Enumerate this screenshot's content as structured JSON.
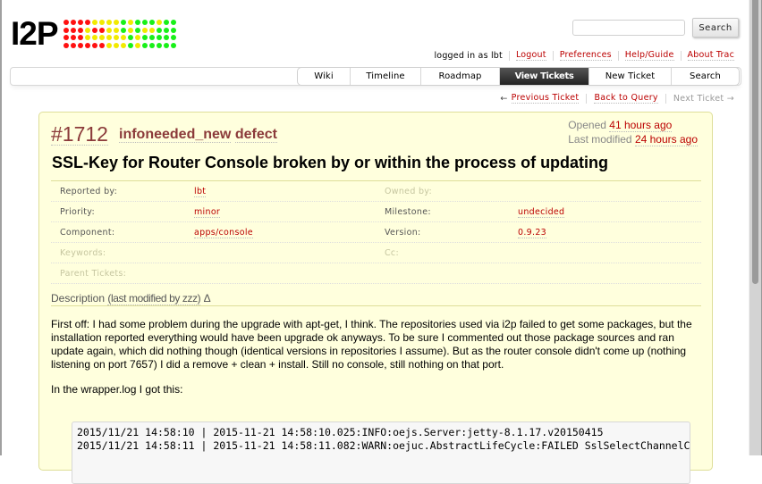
{
  "logo": {
    "text": "I2P",
    "dot_rows": [
      "RRRRYYYYGYGGGYGG",
      "RRRYRRYYGYGYYGGG",
      "RRRYYYYYYGYGGGGG",
      "RRRRRRYYYGYGGGGG"
    ]
  },
  "search": {
    "value": "",
    "button": "Search"
  },
  "metanav": {
    "logged_in": "logged in as lbt",
    "links": [
      "Logout",
      "Preferences",
      "Help/Guide",
      "About Trac"
    ]
  },
  "mainnav": {
    "tabs": [
      {
        "label": "Wiki",
        "active": false
      },
      {
        "label": "Timeline",
        "active": false
      },
      {
        "label": "Roadmap",
        "active": false
      },
      {
        "label": "View Tickets",
        "active": true
      },
      {
        "label": "New Ticket",
        "active": false
      },
      {
        "label": "Search",
        "active": false
      }
    ]
  },
  "ctxtnav": {
    "prev_arrow": "←",
    "prev": "Previous Ticket",
    "back": "Back to Query",
    "next": "Next Ticket →"
  },
  "ticket": {
    "id": "#1712",
    "status": "infoneeded_new",
    "type": "defect",
    "opened_label": "Opened",
    "opened": "41 hours ago",
    "modified_label": "Last modified",
    "modified": "24 hours ago",
    "summary": "SSL-Key for Router Console broken by or within the process of updating",
    "properties": [
      {
        "l1": "Reported by:",
        "v1": "lbt",
        "l2": "Owned by:",
        "v2": ""
      },
      {
        "l1": "Priority:",
        "v1": "minor",
        "l2": "Milestone:",
        "v2": "undecided"
      },
      {
        "l1": "Component:",
        "v1": "apps/console",
        "l2": "Version:",
        "v2": "0.9.23"
      },
      {
        "l1": "Keywords:",
        "v1": "",
        "l2": "Cc:",
        "v2": ""
      },
      {
        "l1": "Parent Tickets:",
        "v1": "",
        "l2": "",
        "v2": ""
      }
    ],
    "description_label": "Description",
    "description_modified": "(last modified by zzz)",
    "diff_symbol": "Δ",
    "description_paragraphs": [
      "First off: I had some problem during the upgrade with apt-get, I think. The repositories used via i2p failed to get some packages, but the installation reported everything would have been upgrade ok anyways. To be sure I commented out those package sources and ran update again, which did nothing though (identical versions in repositories I assume). But as the router console didn't come up (nothing listening on port 7657) I did a remove + clean + install. Still no console, still nothing on that port.",
      "In the wrapper.log I got this:"
    ],
    "log_lines": [
      "2015/11/21 14:58:10 | 2015-11-21 14:58:10.025:INFO:oejs.Server:jetty-8.1.17.v20150415",
      "2015/11/21 14:58:11 | 2015-11-21 14:58:11.082:WARN:oejuc.AbstractLifeCycle:FAILED SslSelectChannelConnector"
    ]
  }
}
